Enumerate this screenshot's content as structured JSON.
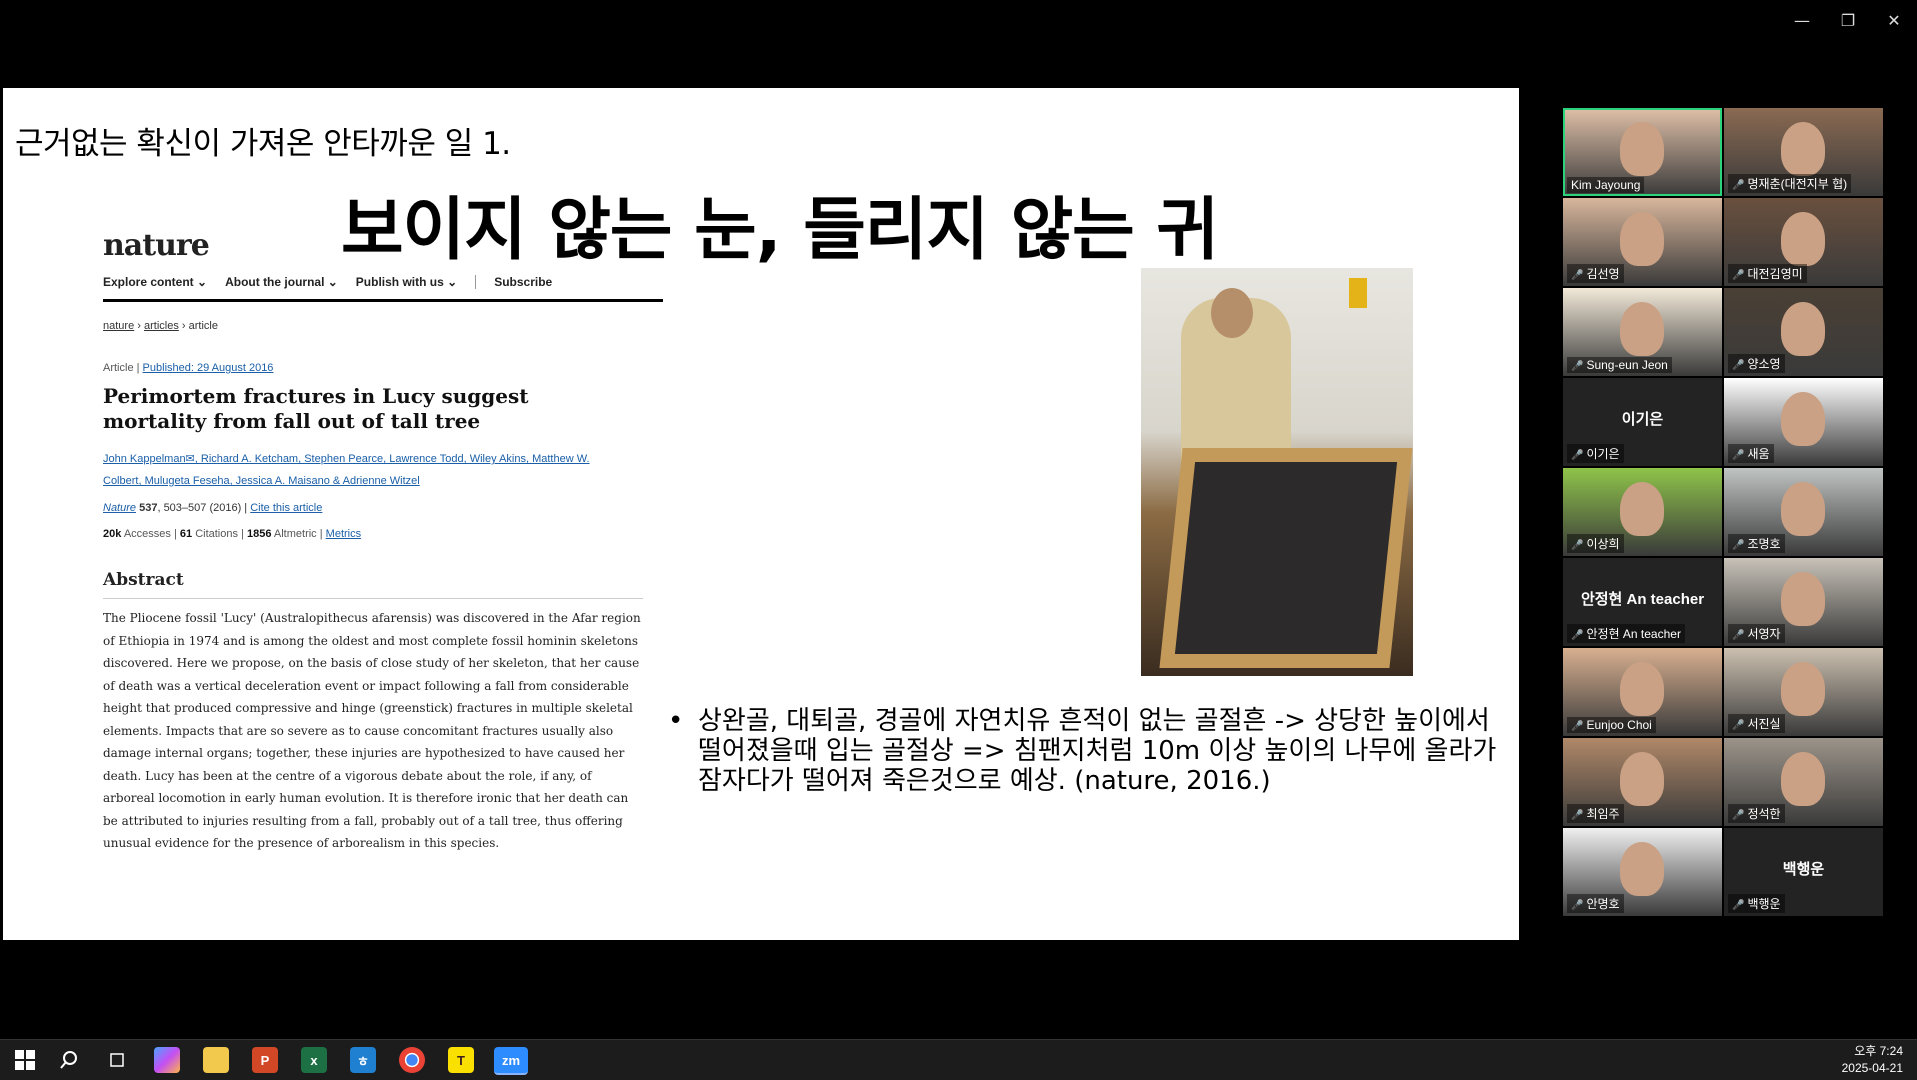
{
  "window_controls": {
    "minimize": "—",
    "restore": "❐",
    "close": "✕"
  },
  "slide": {
    "heading1": "근거없는 확신이 가져온 안타까운 일 1.",
    "heading2": "보이지 않는 눈, 들리지 않는 귀",
    "bullet": "상완골, 대퇴골, 경골에 자연치유 흔적이 없는 골절흔 -> 상당한 높이에서 떨어졌을때 입는 골절상 => 침팬지처럼 10m 이상 높이의 나무에 올라가 잠자다가 떨어져 죽은것으로 예상. (nature, 2016.)",
    "bullet_mark": "•"
  },
  "nature": {
    "logo": "nature",
    "nav": [
      "Explore content ⌄",
      "About the journal ⌄",
      "Publish with us ⌄",
      "Subscribe"
    ],
    "crumbs": [
      "nature",
      "articles",
      "article"
    ],
    "crumb_sep": "›",
    "article_type": "Article",
    "published": "Published: 29 August 2016",
    "title": "Perimortem fractures in Lucy suggest mortality from fall out of tall tree",
    "authors": "John Kappelman✉, Richard A. Ketcham, Stephen Pearce, Lawrence Todd, Wiley Akins, Matthew W. Colbert, Mulugeta Feseha, Jessica A. Maisano & Adrienne Witzel",
    "journal": "Nature",
    "volume": "537",
    "pages": ", 503–507 (2016)",
    "cite": "Cite this article",
    "accesses_n": "20k",
    "accesses_l": "Accesses",
    "citations_n": "61",
    "citations_l": "Citations",
    "altmetric_n": "1856",
    "altmetric_l": "Altmetric",
    "metrics": "Metrics",
    "abstract_heading": "Abstract",
    "abstract": "The Pliocene fossil 'Lucy' (Australopithecus afarensis) was discovered in the Afar region of Ethiopia in 1974 and is among the oldest and most complete fossil hominin skeletons discovered. Here we propose, on the basis of close study of her skeleton, that her cause of death was a vertical deceleration event or impact following a fall from considerable height that produced compressive and hinge (greenstick) fractures in multiple skeletal elements. Impacts that are so severe as to cause concomitant fractures usually also damage internal organs; together, these injuries are hypothesized to have caused her death. Lucy has been at the centre of a vigorous debate about the role, if any, of arboreal locomotion in early human evolution. It is therefore ironic that her death can be attributed to injuries resulting from a fall, probably out of a tall tree, thus offering unusual evidence for the presence of arborealism in this species."
  },
  "participants": [
    {
      "name": "Kim Jayoung",
      "muted": false,
      "video": true,
      "active": true
    },
    {
      "name": "명재춘(대전지부 협)",
      "muted": true,
      "video": true
    },
    {
      "name": "김선영",
      "muted": true,
      "video": true
    },
    {
      "name": "대전김영미",
      "muted": true,
      "video": true
    },
    {
      "name": "Sung-eun Jeon",
      "muted": true,
      "video": true
    },
    {
      "name": "양소영",
      "muted": true,
      "video": true
    },
    {
      "name": "이기은",
      "muted": true,
      "video": false,
      "display": "이기은"
    },
    {
      "name": "새움",
      "muted": true,
      "video": true
    },
    {
      "name": "이상희",
      "muted": true,
      "video": true
    },
    {
      "name": "조명호",
      "muted": true,
      "video": true
    },
    {
      "name": "안정현 An teacher",
      "muted": true,
      "video": false,
      "display": "안정현 An teacher"
    },
    {
      "name": "서영자",
      "muted": true,
      "video": true
    },
    {
      "name": "Eunjoo Choi",
      "muted": true,
      "video": true
    },
    {
      "name": "서진실",
      "muted": true,
      "video": true
    },
    {
      "name": "최임주",
      "muted": true,
      "video": true
    },
    {
      "name": "정석한",
      "muted": true,
      "video": true
    },
    {
      "name": "안명호",
      "muted": true,
      "video": true
    },
    {
      "name": "백행운",
      "muted": true,
      "video": false,
      "display": "백행운"
    }
  ],
  "taskbar": {
    "apps": [
      "start",
      "search",
      "task-view",
      "copilot",
      "file-explorer",
      "powerpoint",
      "excel",
      "hangul",
      "chrome",
      "kakaotalk",
      "zoom"
    ],
    "time": "오후 7:24",
    "date": "2025-04-21"
  },
  "colors": {
    "active_speaker": "#2bd47a",
    "muted_mic": "#e33333",
    "link": "#1a5fa8"
  }
}
